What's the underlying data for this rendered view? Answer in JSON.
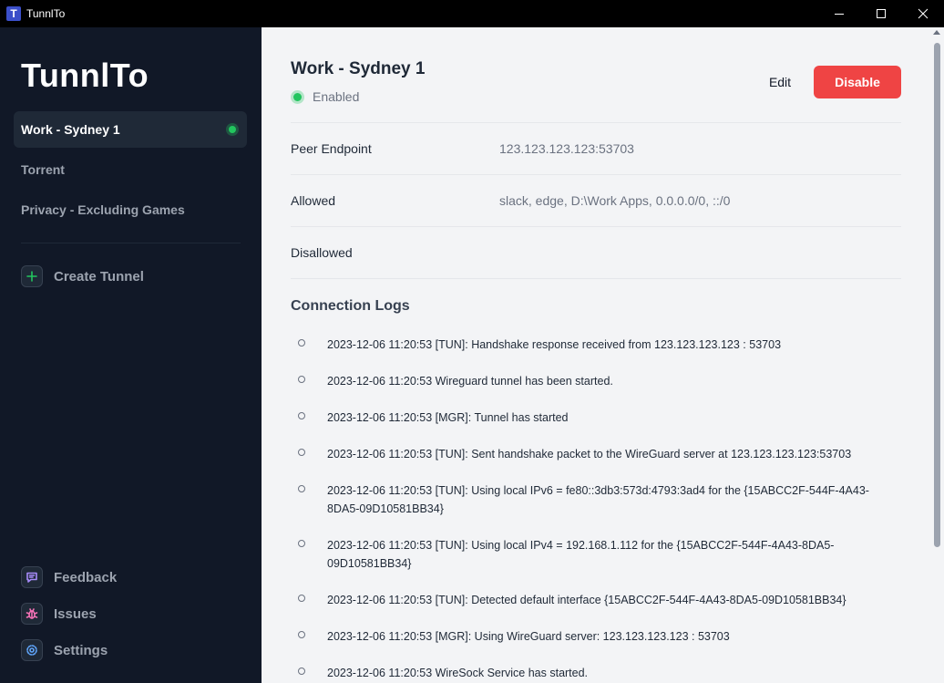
{
  "window": {
    "title": "TunnlTo",
    "icon_letter": "T"
  },
  "sidebar": {
    "logo": "TunnlTo",
    "tunnels": [
      {
        "label": "Work - Sydney 1",
        "active": true
      },
      {
        "label": "Torrent",
        "active": false
      },
      {
        "label": "Privacy - Excluding Games",
        "active": false
      }
    ],
    "create_tunnel": "Create Tunnel",
    "feedback": "Feedback",
    "issues": "Issues",
    "settings": "Settings"
  },
  "main": {
    "title": "Work - Sydney 1",
    "status": "Enabled",
    "edit_label": "Edit",
    "disable_label": "Disable",
    "details": [
      {
        "label": "Peer Endpoint",
        "value": "123.123.123.123:53703"
      },
      {
        "label": "Allowed",
        "value": "slack, edge, D:\\Work Apps, 0.0.0.0/0, ::/0"
      },
      {
        "label": "Disallowed",
        "value": ""
      }
    ],
    "logs_heading": "Connection Logs",
    "logs": [
      "2023-12-06 11:20:53 [TUN]: Handshake response received from 123.123.123.123 : 53703",
      "2023-12-06 11:20:53 Wireguard tunnel has been started.",
      "2023-12-06 11:20:53 [MGR]: Tunnel has started",
      "2023-12-06 11:20:53 [TUN]: Sent handshake packet to the WireGuard server at 123.123.123.123:53703",
      "2023-12-06 11:20:53 [TUN]: Using local IPv6 = fe80::3db3:573d:4793:3ad4 for the {15ABCC2F-544F-4A43-8DA5-09D10581BB34}",
      "2023-12-06 11:20:53 [TUN]: Using local IPv4 = 192.168.1.112 for the {15ABCC2F-544F-4A43-8DA5-09D10581BB34}",
      "2023-12-06 11:20:53 [TUN]: Detected default interface {15ABCC2F-544F-4A43-8DA5-09D10581BB34}",
      "2023-12-06 11:20:53 [MGR]: Using WireGuard server: 123.123.123.123 : 53703",
      "2023-12-06 11:20:53 WireSock Service has started."
    ]
  },
  "colors": {
    "sidebar_bg": "#111827",
    "active_item_bg": "#1f2937",
    "status_green": "#22c55e",
    "disable_red": "#ef4444",
    "main_bg": "#f3f4f6"
  },
  "icons": {
    "app": "app-logo-icon",
    "minimize": "minimize-icon",
    "maximize": "maximize-icon",
    "close": "close-icon",
    "create": "plus-icon",
    "feedback": "chat-bubble-icon",
    "issues": "bug-icon",
    "settings": "gear-icon"
  }
}
